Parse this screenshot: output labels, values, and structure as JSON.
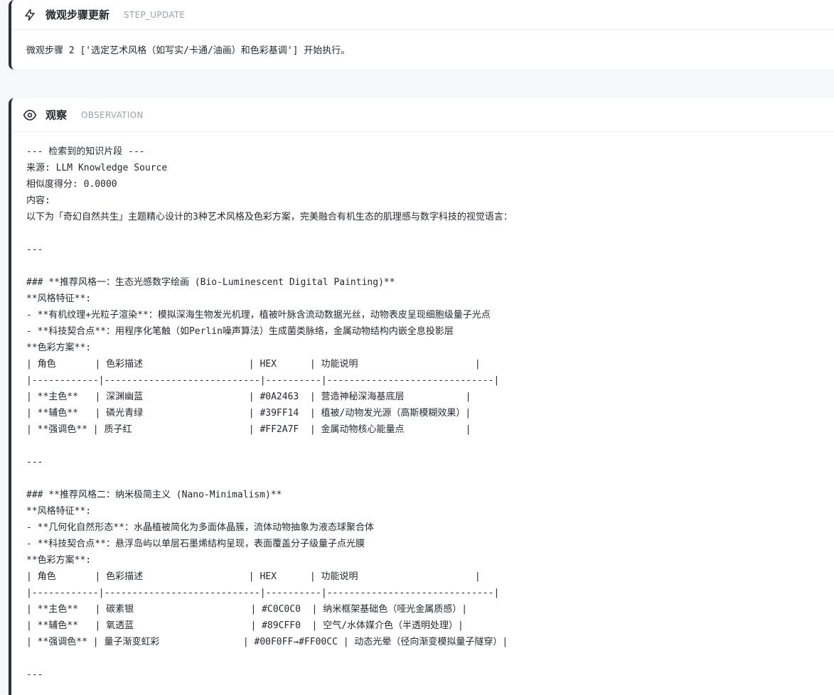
{
  "step_update": {
    "title": "微观步骤更新",
    "tag": "STEP_UPDATE",
    "message": "微观步骤 2 ['选定艺术风格（如写实/卡通/油画）和色彩基调'] 开始执行。"
  },
  "observation": {
    "title": "观察",
    "tag": "OBSERVATION",
    "lines": [
      "--- 检索到的知识片段 ---",
      "来源: LLM Knowledge Source",
      "相似度得分: 0.0000",
      "内容:",
      "以下为「奇幻自然共生」主题精心设计的3种艺术风格及色彩方案，完美融合有机生态的肌理感与数字科技的视觉语言：",
      "",
      "---",
      "",
      "### **推荐风格一：生态光感数字绘画 (Bio-Luminescent Digital Painting)**",
      "**风格特征**:",
      "- **有机纹理+光粒子渲染**：模拟深海生物发光机理，植被叶脉含流动数据光丝，动物表皮呈现细胞级量子光点",
      "- **科技契合点**：用程序化笔触（如Perlin噪声算法）生成菌类脉络，金属动物结构内嵌全息投影层",
      "**色彩方案**:",
      "| 角色       | 色彩描述                   | HEX      | 功能说明                     |",
      "|------------|----------------------------|----------|------------------------------|",
      "| **主色**   | 深渊幽蓝                   | #0A2463  | 营造神秘深海基底层           |",
      "| **辅色**   | 磷光青绿                   | #39FF14  | 植被/动物发光源（高斯模糊效果）|",
      "| **强调色** | 质子红                     | #FF2A7F  | 金属动物核心能量点           |",
      "",
      "---",
      "",
      "### **推荐风格二：纳米极简主义 (Nano-Minimalism)**",
      "**风格特征**:",
      "- **几何化自然形态**：水晶植被简化为多面体晶簇，流体动物抽象为液态球聚合体",
      "- **科技契合点**：悬浮岛屿以单层石墨烯结构呈现，表面覆盖分子级量子点光膜",
      "**色彩方案**:",
      "| 角色       | 色彩描述                   | HEX      | 功能说明                     |",
      "|------------|----------------------------|----------|------------------------------|",
      "| **主色**   | 碳素银                     | #C0C0C0  | 纳米框架基础色（哑光金属质感）|",
      "| **辅色**   | 氧透蓝                     | #89CFF0  | 空气/水体媒介色（半透明处理）|",
      "| **强调色** | 量子渐变虹彩               | #00F0FF→#FF00CC | 动态光晕（径向渐变模拟量子隧穿）|",
      "",
      "---"
    ]
  },
  "colors": {
    "card_border": "#2a2f3a",
    "background": "#f7f8fa",
    "tag_text": "#9aa1ab"
  },
  "icons": {
    "step_icon": "lightning-bolt-icon",
    "observation_icon": "eye-icon"
  }
}
